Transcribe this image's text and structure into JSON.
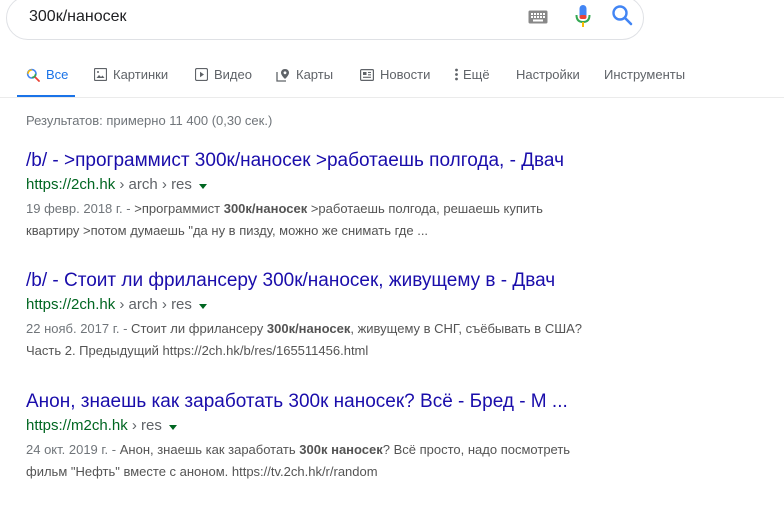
{
  "search": {
    "query": "300к/наносек"
  },
  "tabs": [
    {
      "label": "Все",
      "icon": "search-icon",
      "active": true
    },
    {
      "label": "Картинки",
      "icon": "image-icon"
    },
    {
      "label": "Видео",
      "icon": "play-icon"
    },
    {
      "label": "Карты",
      "icon": "map-pin-icon"
    },
    {
      "label": "Новости",
      "icon": "newspaper-icon"
    },
    {
      "label": "Ещё",
      "icon": "more-vert-icon"
    },
    {
      "label": "Настройки"
    },
    {
      "label": "Инструменты"
    }
  ],
  "stats": "Результатов: примерно 11 400 (0,30 сек.)",
  "results": [
    {
      "title": "/b/ - >программист 300к/наносек >работаешь полгода, - Двач",
      "url_host": "https://2ch.hk",
      "url_crumbs": "› arch › res",
      "date": "19 февр. 2018 г. -",
      "snippet_pre": " >программист ",
      "snippet_bold": "300к/наносек",
      "snippet_post": " >работаешь полгода, решаешь купить",
      "snippet_line2": "квартиру >потом думаешь \"да ну в пизду, можно же снимать где ..."
    },
    {
      "title": "/b/ - Стоит ли фрилансеру 300к/наносек, живущему в - Двач",
      "url_host": "https://2ch.hk",
      "url_crumbs": "› arch › res",
      "date": "22 нояб. 2017 г. -",
      "snippet_pre": " Стоит ли фрилансеру ",
      "snippet_bold": "300к/наносек",
      "snippet_post": ", живущему в СНГ, съёбывать в США?",
      "snippet_line2": "Часть 2. Предыдущий https://2ch.hk/b/res/165511456.html"
    },
    {
      "title": "Анон, знаешь как заработать 300к наносек? Всё - Бред - М ...",
      "url_host": "https://m2ch.hk",
      "url_crumbs": "› res",
      "date": "24 окт. 2019 г. -",
      "snippet_pre": " Анон, знаешь как заработать ",
      "snippet_bold": "300к наносек",
      "snippet_post": "? Всё просто, надо посмотреть",
      "snippet_line2": "фильм \"Нефть\" вместе с аноном. https://tv.2ch.hk/r/random"
    }
  ],
  "colors": {
    "accent": "#1a73e8",
    "link": "#1a0dab",
    "url": "#006621"
  }
}
